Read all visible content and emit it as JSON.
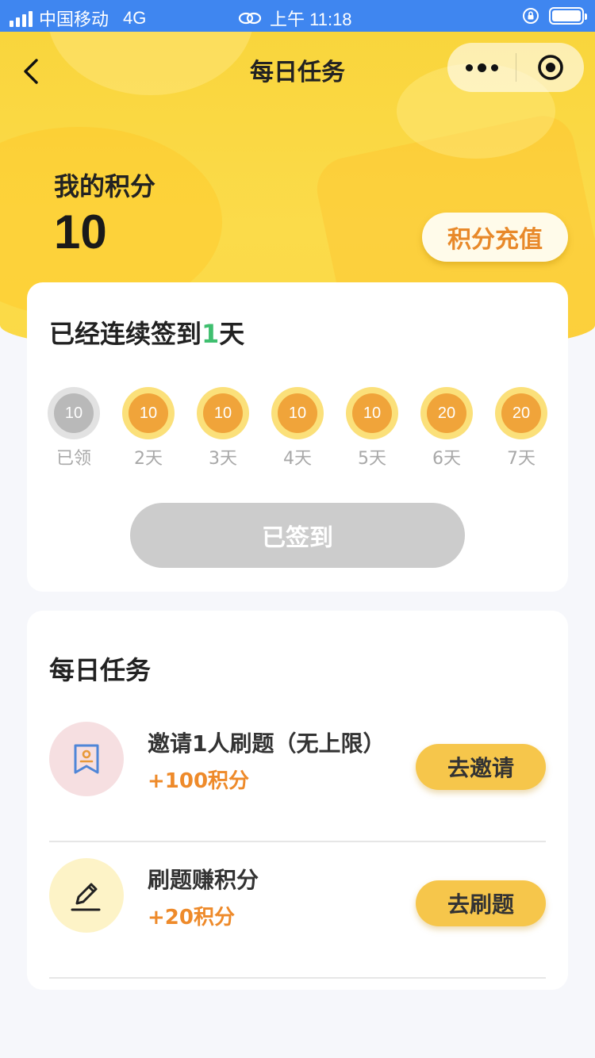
{
  "status_bar": {
    "carrier": "中国移动",
    "network": "4G",
    "time": "上午 11:18"
  },
  "nav": {
    "title": "每日任务",
    "back_icon": "chevron-left-icon",
    "more_icon": "more-dots-icon",
    "close_icon": "target-circle-icon"
  },
  "points": {
    "label": "我的积分",
    "value": "10",
    "recharge_label": "积分充值"
  },
  "signin": {
    "title_prefix": "已经连续签到",
    "streak_days": "1",
    "title_suffix": "天",
    "days": [
      {
        "points": "10",
        "label": "已领",
        "claimed": true
      },
      {
        "points": "10",
        "label": "2天",
        "claimed": false
      },
      {
        "points": "10",
        "label": "3天",
        "claimed": false
      },
      {
        "points": "10",
        "label": "4天",
        "claimed": false
      },
      {
        "points": "10",
        "label": "5天",
        "claimed": false
      },
      {
        "points": "20",
        "label": "6天",
        "claimed": false
      },
      {
        "points": "20",
        "label": "7天",
        "claimed": false
      }
    ],
    "button_label": "已签到"
  },
  "tasks": {
    "title": "每日任务",
    "items": [
      {
        "name": "邀请1人刷题（无上限）",
        "reward": "+100积分",
        "button": "去邀请",
        "icon": "bookmark-person-icon"
      },
      {
        "name": "刷题赚积分",
        "reward": "+20积分",
        "button": "去刷题",
        "icon": "pencil-icon"
      }
    ]
  },
  "colors": {
    "status_bar": "#3f86f0",
    "hero_yellow": "#fbd946",
    "accent_orange": "#ee8a2a",
    "streak_green": "#3fbf6f",
    "task_button": "#f6c64b"
  }
}
